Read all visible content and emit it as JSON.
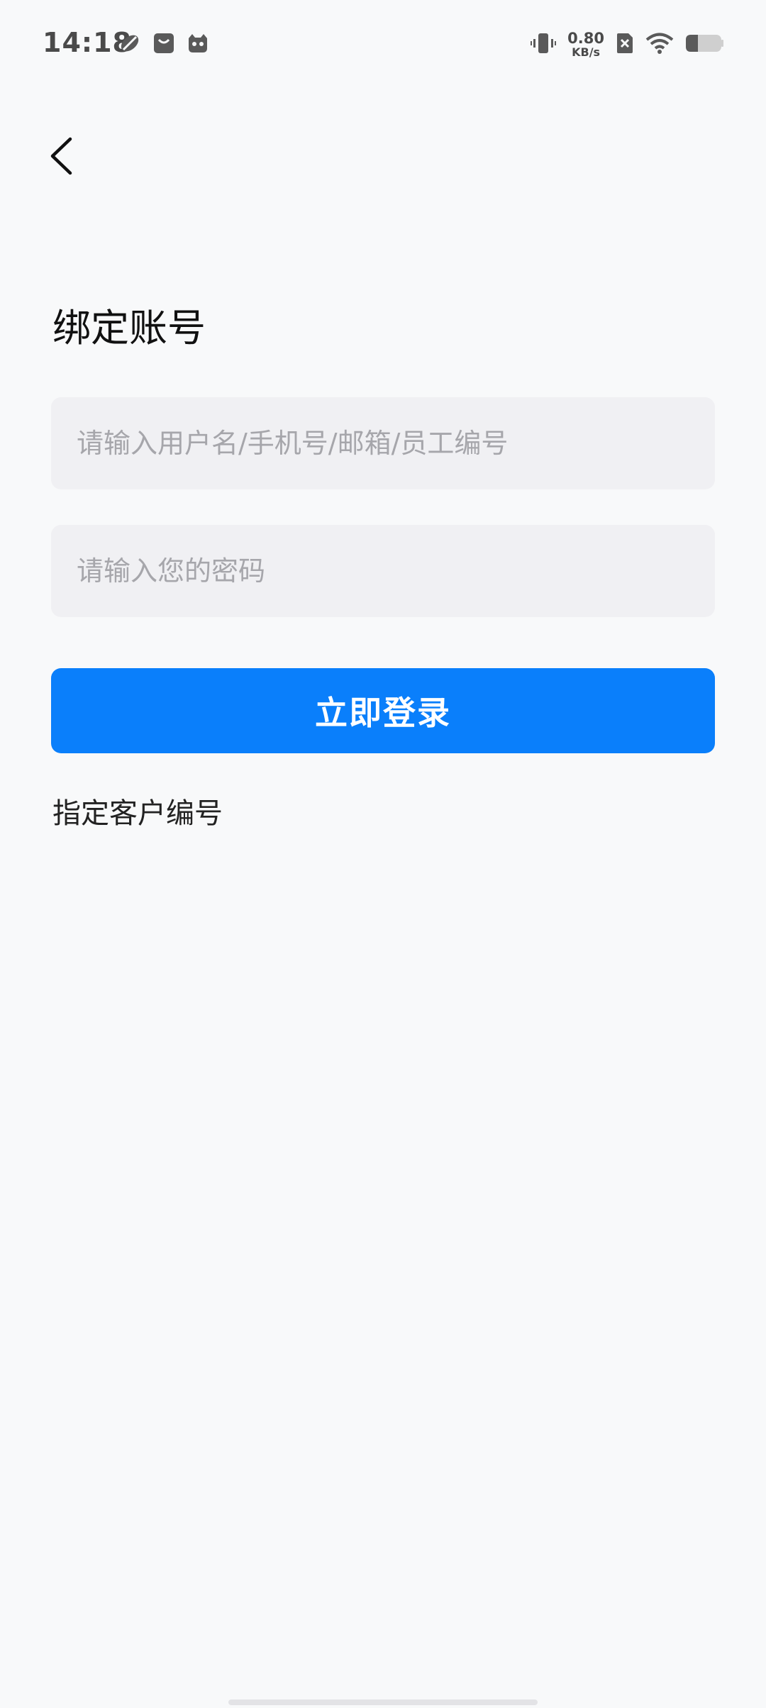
{
  "status_bar": {
    "time": "14:18",
    "net_speed_value": "0.80",
    "net_speed_unit": "KB/s",
    "left_icons": [
      "leaf-notification-icon",
      "shopping-bag-notification-icon",
      "cat-notification-icon"
    ],
    "right_icons": [
      "vibrate-icon",
      "net-speed",
      "sim-disabled-icon",
      "wifi-icon",
      "battery-icon"
    ]
  },
  "header": {
    "back_icon": "chevron-left-icon"
  },
  "page": {
    "title": "绑定账号"
  },
  "form": {
    "username_placeholder": "请输入用户名/手机号/邮箱/员工编号",
    "username_value": "",
    "password_placeholder": "请输入您的密码",
    "password_value": "",
    "login_label": "立即登录",
    "customer_code_label": "指定客户编号"
  },
  "colors": {
    "background": "#f8f9fa",
    "input_background": "#f0f0f3",
    "placeholder": "#a6a6ab",
    "primary": "#0a7ffb",
    "text": "#111111"
  }
}
